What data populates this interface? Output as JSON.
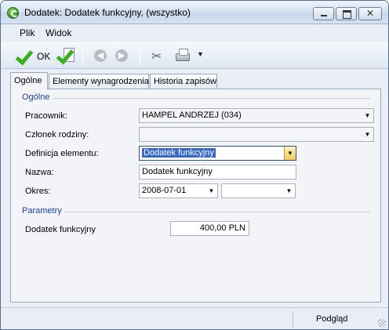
{
  "window": {
    "title": "Dodatek: Dodatek funkcyjny, (wszystko)"
  },
  "menu": {
    "items": [
      "Plik",
      "Widok"
    ]
  },
  "toolbar": {
    "ok_label": "OK"
  },
  "tabs": [
    {
      "label": "Ogólne",
      "active": true
    },
    {
      "label": "Elementy wynagrodzenia",
      "active": false
    },
    {
      "label": "Historia zapisów",
      "active": false
    }
  ],
  "general_group": {
    "title": "Ogólne",
    "employee_label": "Pracownik:",
    "employee_value": "HAMPEL ANDRZEJ (034)",
    "family_label": "Członek rodziny:",
    "family_value": "",
    "definition_label": "Definicja elementu:",
    "definition_value": "Dodatek funkcyjny",
    "name_label": "Nazwa:",
    "name_value": "Dodatek funkcyjny",
    "period_label": "Okres:",
    "period_from": "2008-07-01",
    "period_to": ""
  },
  "params_group": {
    "title": "Parametry",
    "allowance_label": "Dodatek funkcyjny",
    "allowance_value": "400,00 PLN"
  },
  "statusbar": {
    "preview_label": "Podgląd"
  },
  "icons": {
    "app": "green-refresh-icon",
    "ok": "green-check-icon",
    "ok_doc": "check-document-icon",
    "back": "arrow-left-circle-icon",
    "forward": "arrow-right-circle-icon",
    "tools": "tools-icon",
    "print": "printer-icon"
  }
}
